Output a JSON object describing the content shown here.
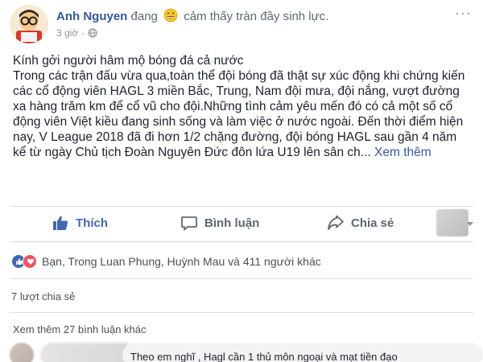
{
  "post": {
    "author": "Anh Nguyen",
    "feeling_prefix": "đang",
    "feeling_icon": "grinning-emoji-icon",
    "feeling_text": "cảm thấy tràn đầy sinh lực.",
    "time": "3 giờ",
    "privacy_icon": "globe-icon",
    "more_label": "···",
    "greeting": "Kính gởi người hâm mộ bóng đá cả nước",
    "body": "Trong các trận đấu vừa qua,toàn thể đội bóng đã thật sự xúc động khi chứng kiến các cổ động viên HAGL 3 miền Bắc, Trung, Nam đội mưa, đội nắng, vượt đường xa hàng trăm km để cổ vũ cho đội.Những tình cảm yêu mến đó có cả một số cổ động viên Việt kiều đang sinh sống và làm việc ở nước ngoài. Đến thời điểm hiện nay, V League 2018 đã đi hơn 1/2 chặng đường, đội bóng HAGL sau gần 4 năm kể từ ngày Chủ tịch Đoàn Nguyên Đức đôn lứa U19 lên sân ch...",
    "see_more": "Xem thêm"
  },
  "actions": {
    "like": "Thích",
    "comment": "Bình luận",
    "share": "Chia sẻ"
  },
  "reactions": {
    "summary": "Bạn, Trong Luan Phung, Huỳnh Mau và 411 người khác"
  },
  "shares": "7 lượt chia sẻ",
  "comments": {
    "more_label": "Xem thêm 27 bình luận khác",
    "preview_text": "Theo em nghĩ , Hagl cần 1 thủ môn ngoại và mạt tiền đạo"
  },
  "colors": {
    "link_blue": "#365899",
    "like_blue": "#4267b2",
    "love_red": "#f25268",
    "muted": "#606770"
  }
}
